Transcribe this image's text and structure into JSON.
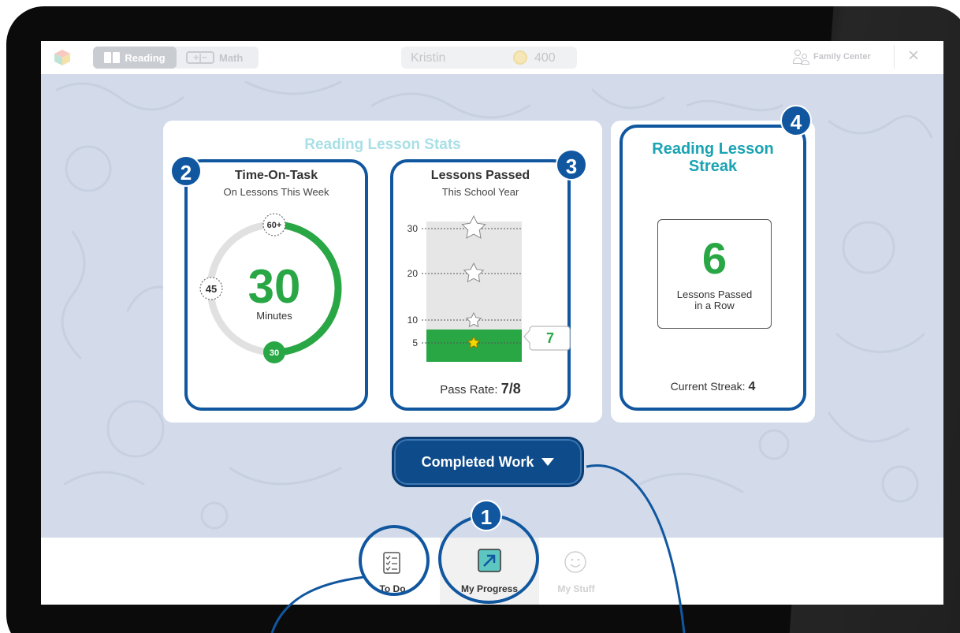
{
  "topbar": {
    "reading_label": "Reading",
    "math_label": "Math",
    "user_name": "Kristin",
    "coins": "400",
    "family_label": "Family Center",
    "close_label": "×"
  },
  "stats": {
    "panel_title": "Reading Lesson Stats",
    "time_on_task": {
      "title": "Time-On-Task",
      "subtitle": "On Lessons This Week",
      "minutes": "30",
      "unit": "Minutes",
      "marker_max": "60+",
      "marker_mid": "45",
      "marker_current": "30",
      "progress_fraction": 0.5
    },
    "lessons_passed": {
      "title": "Lessons Passed",
      "subtitle": "This School Year",
      "y_ticks": [
        "30",
        "20",
        "10",
        "5"
      ],
      "value": "7",
      "pass_rate_label": "Pass Rate:",
      "pass_rate": "7/8"
    }
  },
  "streak": {
    "title_line1": "Reading Lesson",
    "title_line2": "Streak",
    "count": "6",
    "label_line1": "Lessons Passed",
    "label_line2": "in a Row",
    "current_label": "Current Streak:",
    "current_value": "4"
  },
  "completed_work_label": "Completed Work",
  "callouts": [
    "1",
    "2",
    "3",
    "4"
  ],
  "nav": {
    "todo": "To Do",
    "progress": "My Progress",
    "stuff": "My Stuff"
  },
  "colors": {
    "brand_blue": "#11579f",
    "green": "#29a745",
    "teal": "#1aa3b3",
    "bg": "#d3dbea"
  },
  "icons": [
    "cube-logo-icon",
    "book-icon",
    "plus-minus-icon",
    "coin-icon",
    "people-icon",
    "close-icon",
    "star-icon",
    "caret-down-icon",
    "checklist-icon",
    "arrow-up-right-icon",
    "smiley-icon"
  ]
}
